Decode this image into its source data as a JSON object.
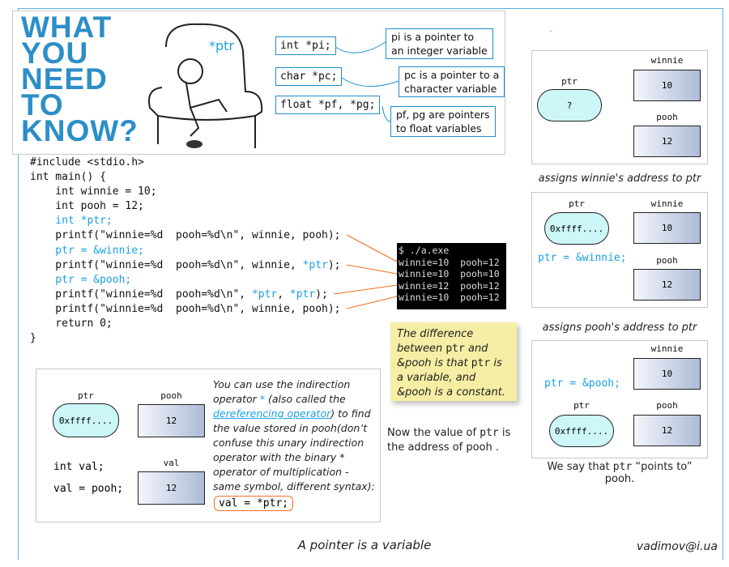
{
  "header": {
    "banner": [
      "WHAT",
      "YOU",
      "NEED",
      "TO",
      "KNOW?"
    ],
    "ptr_label": "*ptr",
    "declarations": [
      {
        "code": "int *pi;",
        "note": [
          "pi  is a pointer to",
          "an integer variable"
        ]
      },
      {
        "code": "char *pc;",
        "note": [
          "pc is a pointer to a",
          "character variable"
        ]
      },
      {
        "code": "float *pf, *pg;",
        "note": [
          "pf, pg are pointers",
          "to float variables"
        ]
      }
    ]
  },
  "dot": ".",
  "code_lines": [
    [
      [
        "#include <stdio.h>",
        ""
      ]
    ],
    [
      [
        "int main() {",
        ""
      ]
    ],
    [
      [
        "    int winnie = 10;",
        ""
      ]
    ],
    [
      [
        "    int pooh = 12;",
        ""
      ]
    ],
    [
      [
        "    int *ptr;",
        "kw"
      ]
    ],
    [
      [
        "    printf(\"winnie=%d  pooh=%d\\n\", winnie, pooh);",
        ""
      ]
    ],
    [
      [
        "    ptr = &winnie;",
        "kw"
      ]
    ],
    [
      [
        "    printf(\"winnie=%d  pooh=%d\\n\", winnie, ",
        ""
      ],
      [
        "*ptr",
        "kw"
      ],
      [
        ");",
        ""
      ]
    ],
    [
      [
        "    ptr = &pooh;",
        "kw"
      ]
    ],
    [
      [
        "    printf(\"winnie=%d  pooh=%d\\n\", ",
        ""
      ],
      [
        "*ptr",
        "kw"
      ],
      [
        ", ",
        ""
      ],
      [
        "*ptr",
        "kw"
      ],
      [
        ");",
        ""
      ]
    ],
    [
      [
        "    printf(\"winnie=%d  pooh=%d\\n\", winnie, pooh);",
        ""
      ]
    ],
    [
      [
        "    return 0;",
        ""
      ]
    ],
    [
      [
        "}",
        ""
      ]
    ]
  ],
  "terminal": [
    "$ ./a.exe",
    "winnie=10  pooh=12",
    "winnie=10  pooh=10",
    "winnie=12  pooh=12",
    "winnie=10  pooh=12"
  ],
  "note": {
    "parts": [
      "The difference between ",
      "ptr",
      " and &pooh  is that ",
      "ptr",
      " is a variable, and &pooh is a constant."
    ]
  },
  "now_value": {
    "a": "Now the value of ",
    "b": "ptr",
    "c": " is the address of pooh ."
  },
  "right": {
    "p1": {
      "ptr": "ptr",
      "ptr_val": "?",
      "winnie": "winnie",
      "winnie_val": "10",
      "pooh": "pooh",
      "pooh_val": "12"
    },
    "c1": "assigns winnie's address to ptr",
    "p2": {
      "ptr": "ptr",
      "ptr_val": "0xffff....",
      "winnie": "winnie",
      "winnie_val": "10",
      "stmt": "ptr = &winnie;",
      "pooh": "pooh",
      "pooh_val": "12"
    },
    "c2": "assigns pooh's address to ptr",
    "p3": {
      "winnie": "winnie",
      "winnie_val": "10",
      "stmt": "ptr = &pooh;",
      "ptr": "ptr",
      "ptr_val": "0xffff....",
      "pooh": "pooh",
      "pooh_val": "12"
    },
    "c3a": "We say that ",
    "c3b": "ptr",
    "c3c": " “points to” pooh."
  },
  "deref": {
    "ptr": "ptr",
    "ptr_val": "0xffff....",
    "pooh": "pooh",
    "pooh_val": "12",
    "decl": "int val;",
    "assign": "val = pooh;",
    "val": "val",
    "val_val": "12",
    "t1": "You can use the indirection operator ",
    "star": "*",
    "t2": " (also called the ",
    "link": "dereferencing operator",
    "t3": ") to find the value stored in pooh(don’t confuse this unary indirection operator with the binary * operator of multiplication - same symbol, different syntax):",
    "code": "val = *ptr;"
  },
  "footer": {
    "title": "A pointer is a variable",
    "email": "vadimov@i.ua"
  },
  "colors": {
    "accent": "#1aa0e6",
    "connector": "#f07020",
    "note": "#f6eea4",
    "terminal": "#000000"
  }
}
